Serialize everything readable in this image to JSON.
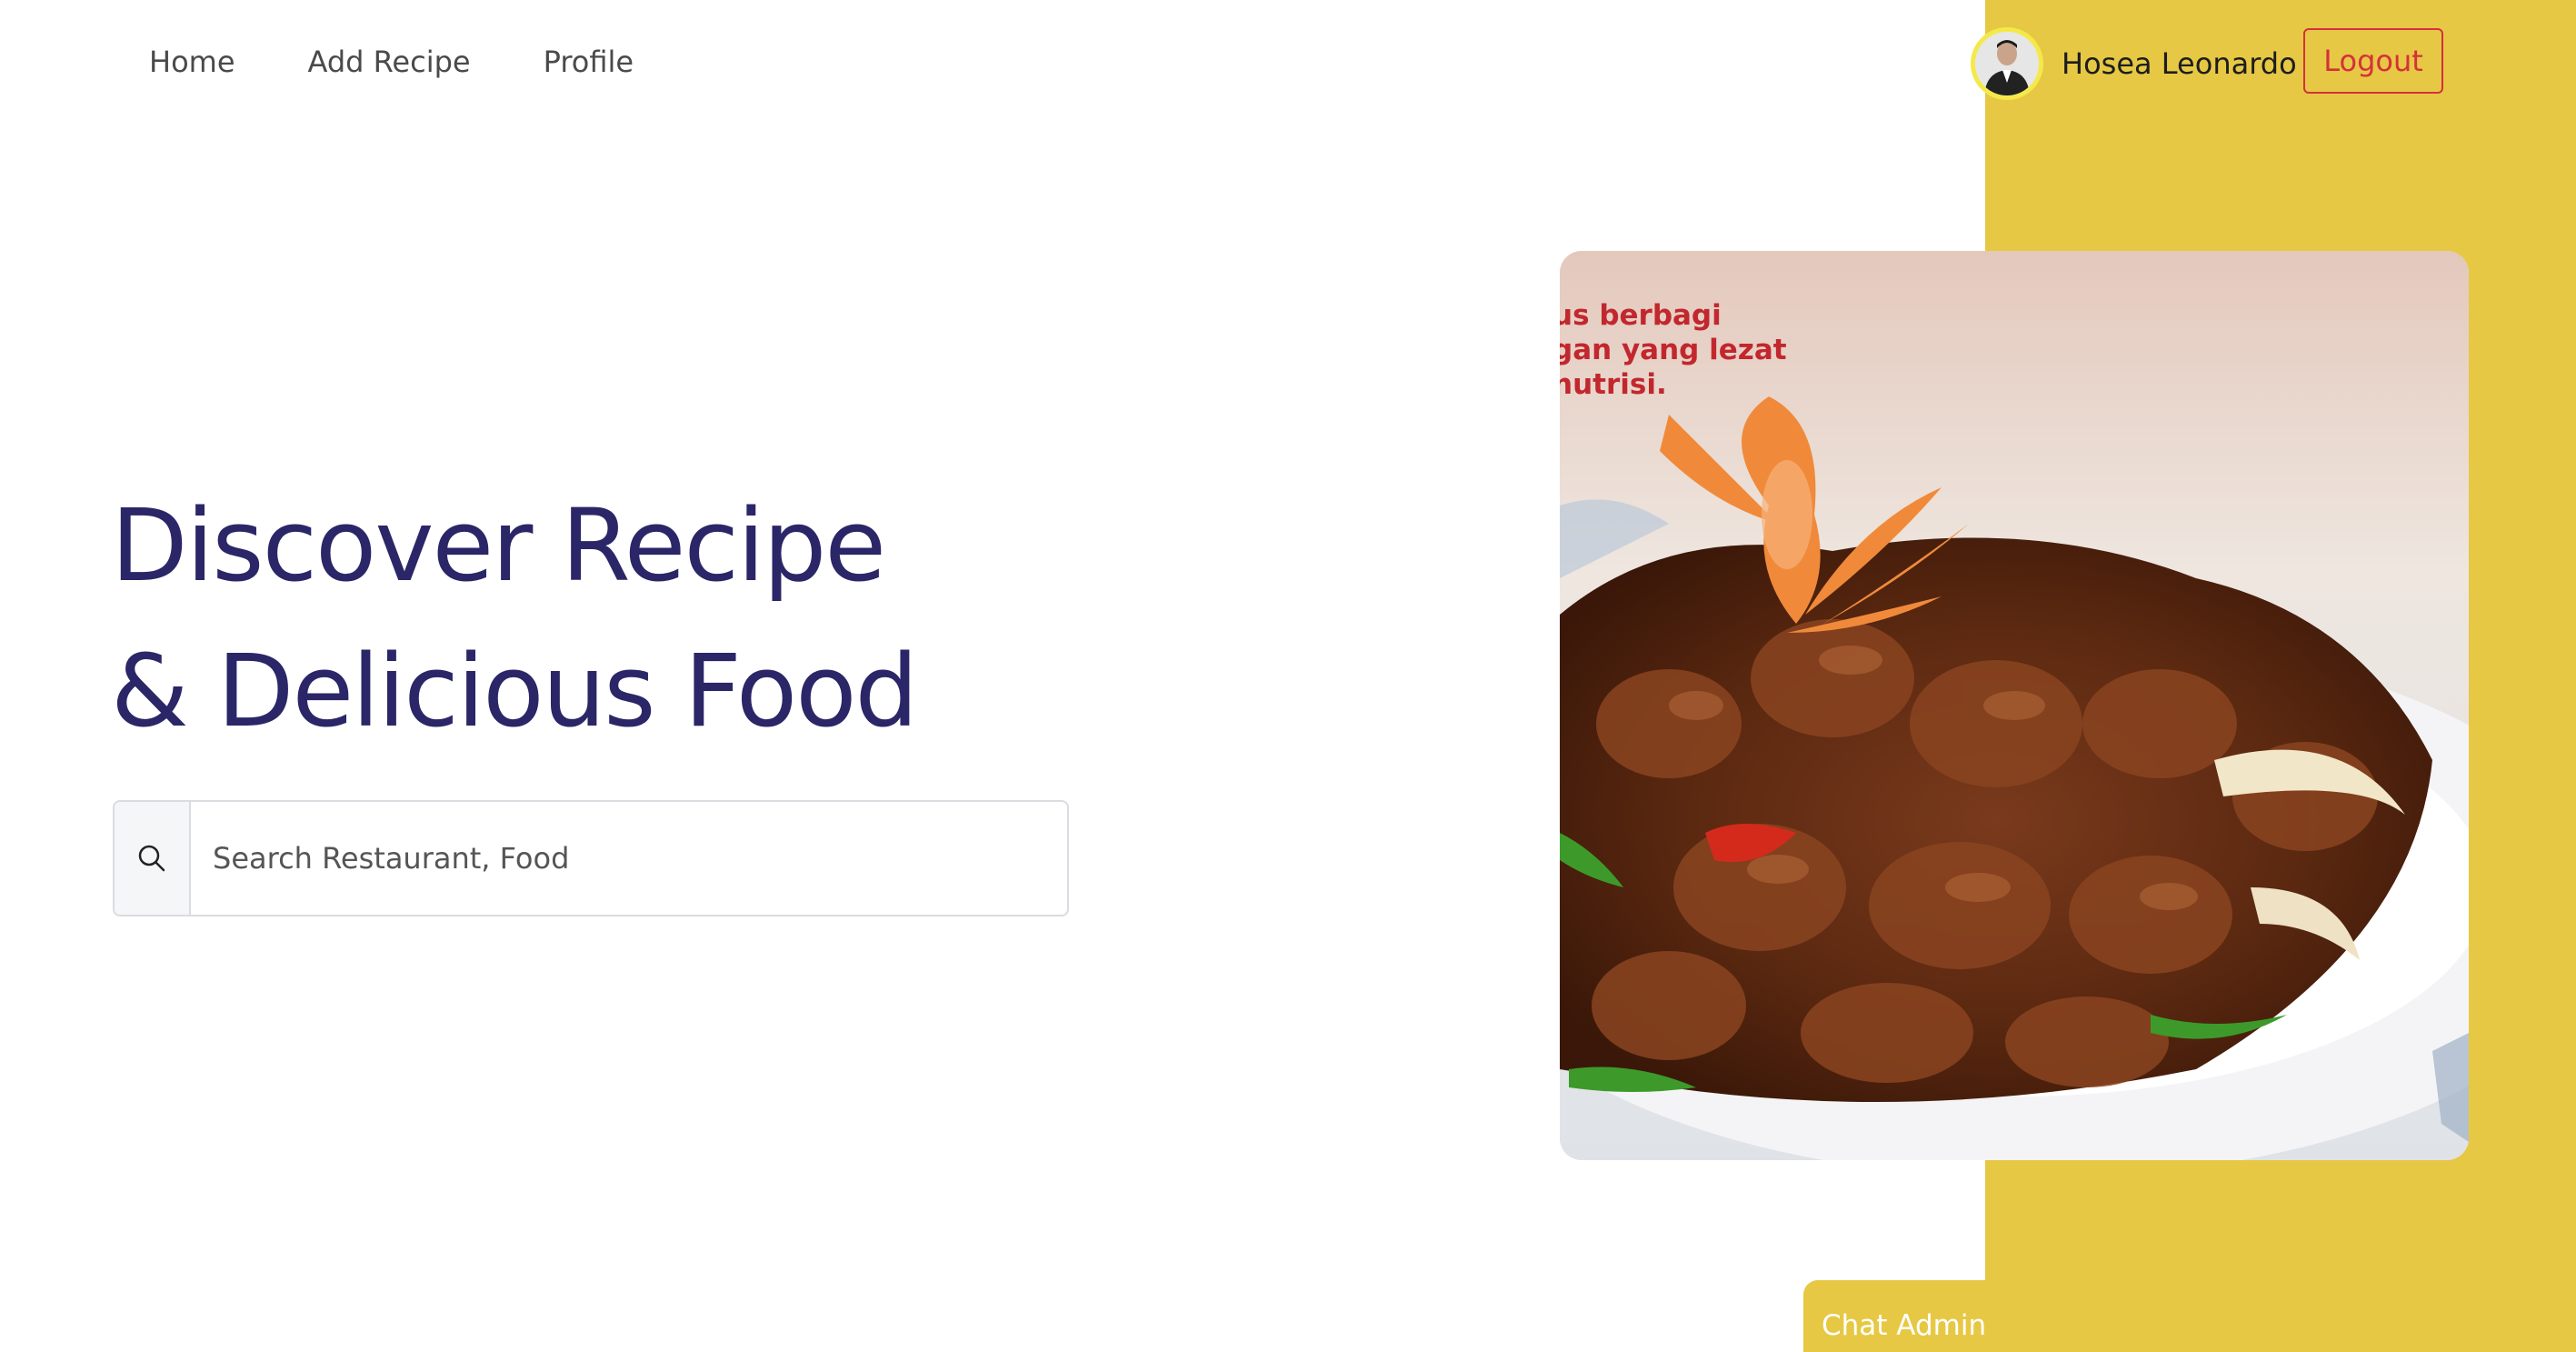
{
  "nav": {
    "items": [
      {
        "label": "Home"
      },
      {
        "label": "Add Recipe"
      },
      {
        "label": "Profile"
      }
    ]
  },
  "user": {
    "name": "Hosea Leonardo",
    "logout_label": "Logout"
  },
  "hero": {
    "title_line1": "Discover Recipe",
    "title_line2": "& Delicious Food"
  },
  "search": {
    "placeholder": "Search Restaurant, Food",
    "icon": "search-icon"
  },
  "food_image": {
    "overlay_lines": [
      "us berbagi",
      "gan yang lezat",
      "nutrisi."
    ]
  },
  "chat": {
    "label": "Chat Admin"
  },
  "colors": {
    "accent_yellow": "#E6C844",
    "title_navy": "#2B2667",
    "logout_red": "#D6303C"
  }
}
